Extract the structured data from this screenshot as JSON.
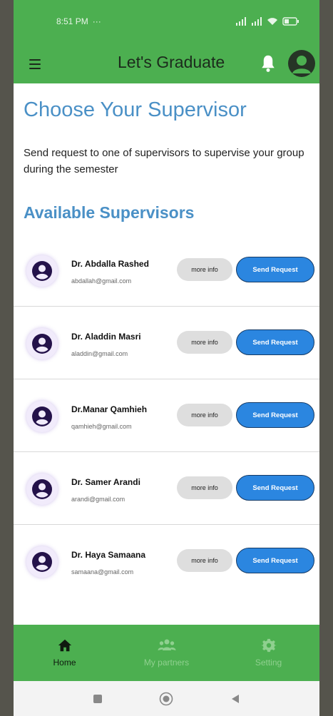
{
  "status_bar": {
    "time": "8:51 PM",
    "extra": "···"
  },
  "app_bar": {
    "title": "Let's Graduate",
    "icons": [
      "menu-icon",
      "bell-icon",
      "account-icon"
    ]
  },
  "page": {
    "title": "Choose Your Supervisor",
    "description": "Send request to one of supervisors to supervise your group during the semester",
    "section_title": "Available Supervisors"
  },
  "supervisors": [
    {
      "name": "Dr. Abdalla Rashed",
      "email": "abdallah@gmail.com"
    },
    {
      "name": "Dr. Aladdin Masri",
      "email": "aladdin@gmail.com"
    },
    {
      "name": "Dr.Manar Qamhieh",
      "email": "qamhieh@gmail.com"
    },
    {
      "name": "Dr. Samer Arandi",
      "email": "arandi@gmail.com"
    },
    {
      "name": "Dr. Haya Samaana",
      "email": "samaana@gmail.com"
    }
  ],
  "buttons": {
    "more_info": "more info",
    "send_request": "Send Request"
  },
  "bottom_nav": [
    {
      "label": "Home",
      "icon": "home-icon",
      "active": true
    },
    {
      "label": "My partners",
      "icon": "group-icon",
      "active": false
    },
    {
      "label": "Setting",
      "icon": "gear-icon",
      "active": false
    }
  ],
  "colors": {
    "primary_green": "#4caf50",
    "heading_blue": "#4a90c6",
    "send_button_blue": "#2b86e0",
    "more_button_gray": "#dedede"
  }
}
